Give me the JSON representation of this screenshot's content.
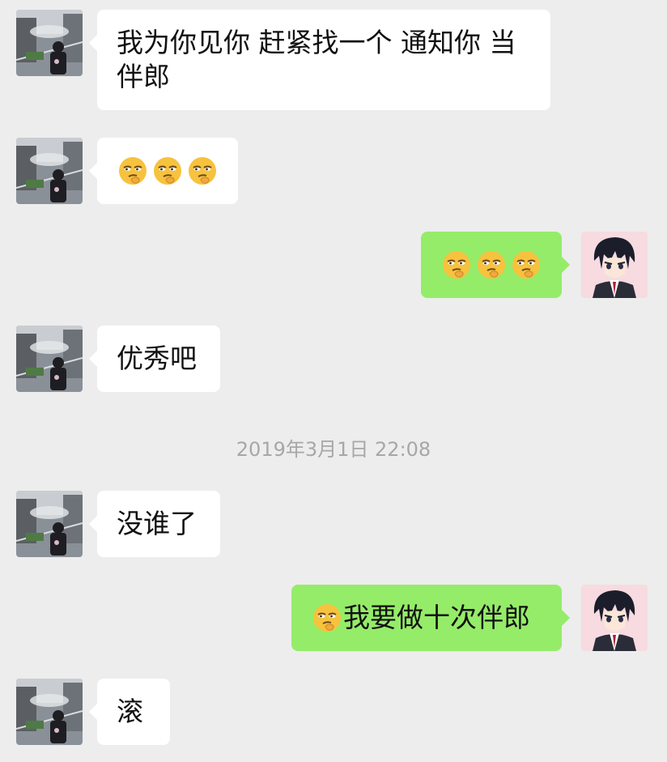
{
  "conversation": {
    "messages": [
      {
        "side": "left",
        "text": "我为你见你 赶紧找一个 通知你 当伴郎",
        "avatar": "friend-avatar-photo"
      },
      {
        "side": "left",
        "emoji_count": 3,
        "emoji_icon": "smirk-thinking-emoji-icon",
        "avatar": "friend-avatar-photo"
      },
      {
        "side": "right",
        "emoji_count": 3,
        "emoji_icon": "smirk-thinking-emoji-icon",
        "avatar": "anime-avatar"
      },
      {
        "side": "left",
        "text": "优秀吧",
        "avatar": "friend-avatar-photo"
      },
      {
        "side": "left",
        "text": "没谁了",
        "avatar": "friend-avatar-photo"
      },
      {
        "side": "right",
        "emoji_icon": "smirk-thinking-emoji-icon",
        "text": "我要做十次伴郎",
        "avatar": "anime-avatar"
      },
      {
        "side": "left",
        "text": "滚",
        "avatar": "friend-avatar-photo"
      }
    ],
    "timestamp": "2019年3月1日 22:08"
  },
  "colors": {
    "background": "#ededed",
    "incoming_bubble": "#ffffff",
    "outgoing_bubble": "#95ec69",
    "timestamp_text": "#a7a7a7"
  }
}
